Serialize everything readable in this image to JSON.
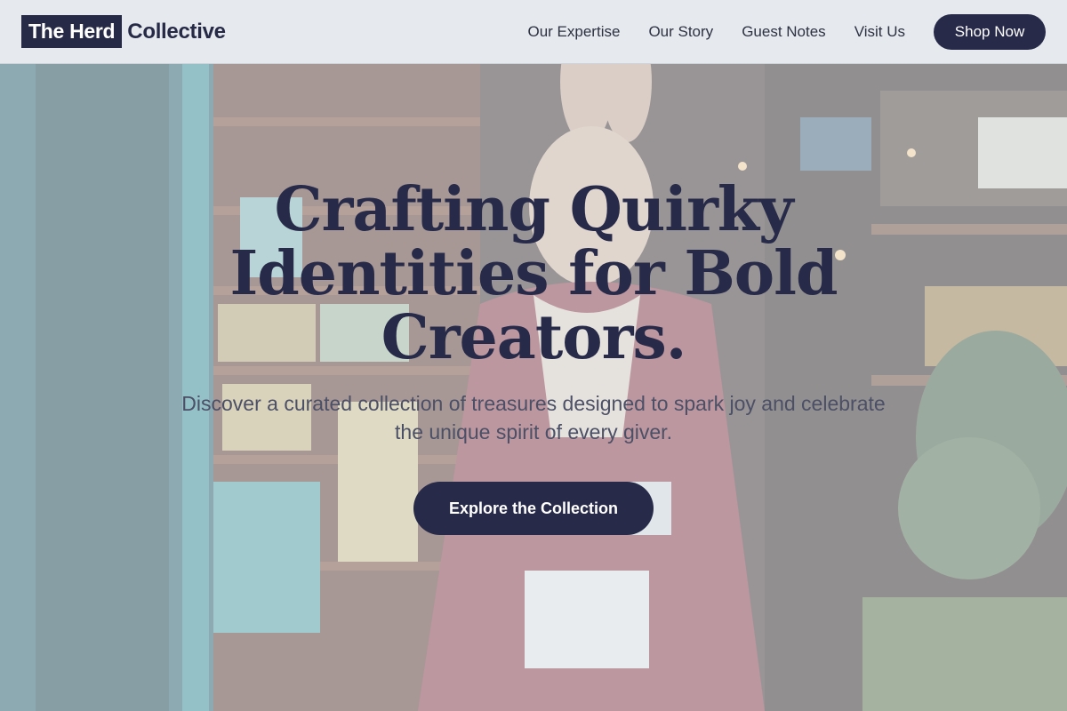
{
  "brand": {
    "name_boxed": "The Herd",
    "name_rest": "Collective"
  },
  "nav": {
    "items": [
      {
        "label": "Our Expertise"
      },
      {
        "label": "Our Story"
      },
      {
        "label": "Guest Notes"
      },
      {
        "label": "Visit Us"
      }
    ],
    "cta_label": "Shop Now"
  },
  "hero": {
    "headline": "Crafting Quirky Identities for Bold Creators.",
    "subtitle": "Discover a curated collection of treasures designed to spark joy and celebrate the unique spirit of every giver.",
    "cta_label": "Explore the Collection"
  },
  "colors": {
    "primary": "#272a48",
    "header_bg": "#e6eaee",
    "text_muted": "#4c5066"
  }
}
